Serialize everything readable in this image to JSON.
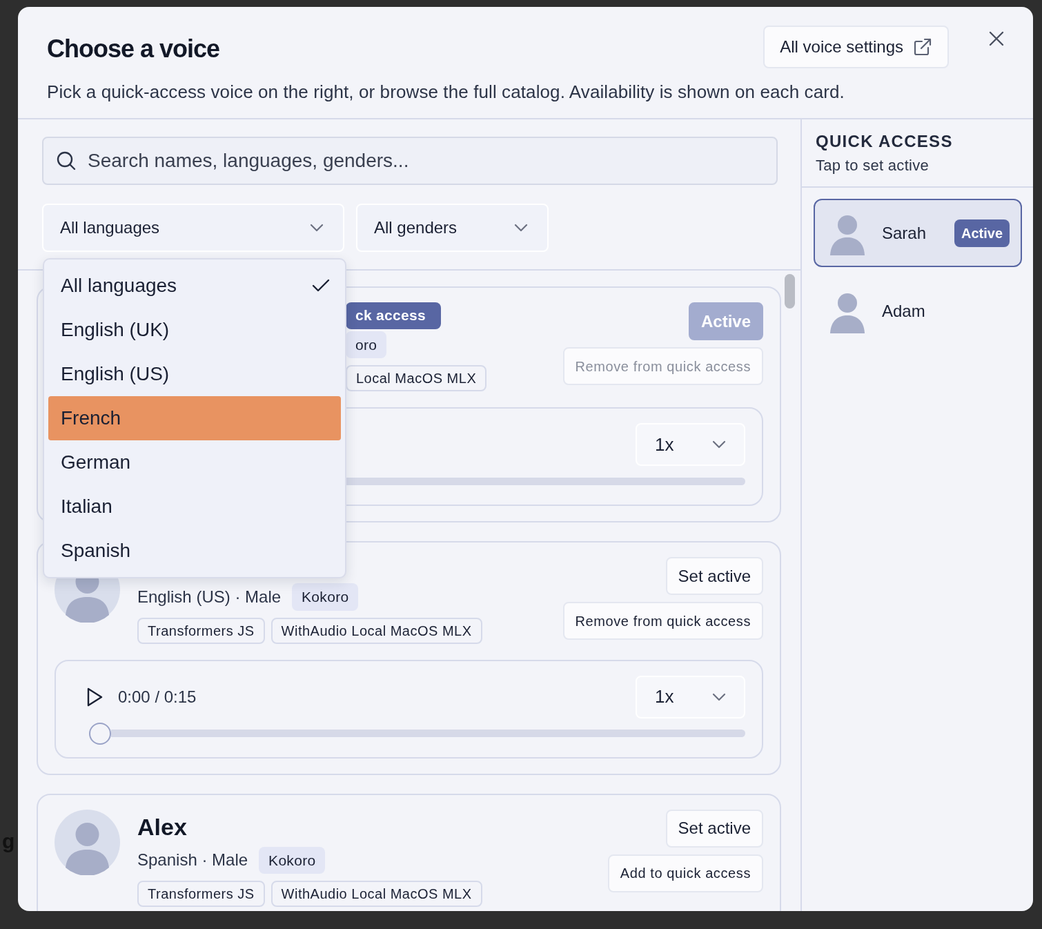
{
  "dialog": {
    "title": "Choose a voice",
    "subtitle": "Pick a quick-access voice on the right, or browse the full catalog. Availability is shown on each card.",
    "settings_button": "All voice settings"
  },
  "search": {
    "placeholder": "Search names, languages, genders..."
  },
  "filters": [
    {
      "label": "All languages",
      "expanded": true
    },
    {
      "label": "All genders",
      "expanded": false
    }
  ],
  "language_menu": [
    {
      "label": "All languages",
      "selected": true,
      "highlighted": false
    },
    {
      "label": "English (UK)",
      "selected": false,
      "highlighted": false
    },
    {
      "label": "English (US)",
      "selected": false,
      "highlighted": false
    },
    {
      "label": "French",
      "selected": false,
      "highlighted": true
    },
    {
      "label": "German",
      "selected": false,
      "highlighted": false
    },
    {
      "label": "Italian",
      "selected": false,
      "highlighted": false
    },
    {
      "label": "Spanish",
      "selected": false,
      "highlighted": false
    }
  ],
  "voices": [
    {
      "covered": true,
      "badge": "ck access",
      "engine": "oro",
      "tags": [
        "Local MacOS MLX"
      ],
      "buttons": [
        {
          "label": "Active",
          "kind": "primary",
          "disabled": true
        },
        {
          "label": "Remove from quick access",
          "kind": "secondary",
          "disabled": true
        }
      ],
      "player": {
        "speed": "1x",
        "level": 0
      }
    },
    {
      "covered": false,
      "meta": "English (US) · Male",
      "engine": "Kokoro",
      "tags": [
        "Transformers JS",
        "WithAudio Local MacOS MLX"
      ],
      "buttons": [
        {
          "label": "Set active",
          "kind": "secondary",
          "disabled": false
        },
        {
          "label": "Remove from quick access",
          "kind": "secondary",
          "disabled": false
        }
      ],
      "player": {
        "time": "0:00 / 0:15",
        "speed": "1x",
        "level": 0
      }
    },
    {
      "covered": false,
      "name": "Alex",
      "meta": "Spanish · Male",
      "engine": "Kokoro",
      "tags": [
        "Transformers JS",
        "WithAudio Local MacOS MLX"
      ],
      "buttons": [
        {
          "label": "Set active",
          "kind": "secondary",
          "disabled": false
        },
        {
          "label": "Add to quick access",
          "kind": "secondary",
          "disabled": false
        }
      ]
    }
  ],
  "quick_access": {
    "title": "QUICK ACCESS",
    "subtitle": "Tap to set active",
    "items": [
      {
        "name": "Sarah",
        "selected": true,
        "badge": "Active"
      },
      {
        "name": "Adam",
        "selected": false
      }
    ]
  },
  "backdrop_text": "g"
}
